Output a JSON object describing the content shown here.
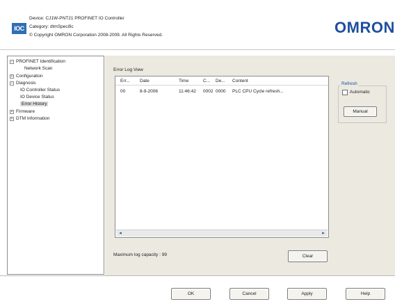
{
  "header": {
    "logo_text": "IOC",
    "device_label": "Device:",
    "device_value": "CJ1W-PNT21 PROFINET IO Controller",
    "category_label": "Category:",
    "category_value": "dtmSpecific",
    "copyright": "© Copyright OMRON Corporation 2008-2009. All Rights Reserved.",
    "brand": "OMRON",
    "brand_color": "#1f4e9e"
  },
  "tree": {
    "items": [
      {
        "label": "PROFINET Identification",
        "expander": "−"
      },
      {
        "label": "Network Scan"
      },
      {
        "label": "Configuration",
        "expander": "+"
      },
      {
        "label": "Diagnosis",
        "expander": "−"
      },
      {
        "label": "IO Controller Status"
      },
      {
        "label": "IO Device Status"
      },
      {
        "label": "Error History",
        "selected": true
      },
      {
        "label": "Firmware",
        "expander": "+"
      },
      {
        "label": "DTM Information",
        "expander": "+"
      }
    ]
  },
  "main": {
    "title": "Error Log View",
    "columns": [
      "Err...",
      "Date",
      "Time",
      "C...",
      "De...",
      "Content"
    ],
    "rows": [
      [
        "00",
        "8-9-2006",
        "11:46:42",
        "0002",
        "0000",
        "PLC CPU Cycle refresh..."
      ]
    ],
    "scroll_left": "◂",
    "scroll_right": "▸",
    "max_capacity": "Maximum log capacity : 99",
    "clear_label": "Clear"
  },
  "refresh": {
    "title": "Refresh",
    "automatic_label": "Automatic",
    "automatic_checked": false,
    "manual_label": "Manual"
  },
  "footer": {
    "ok_label": "OK",
    "cancel_label": "Cancel",
    "apply_label": "Apply",
    "help_label": "Help"
  }
}
